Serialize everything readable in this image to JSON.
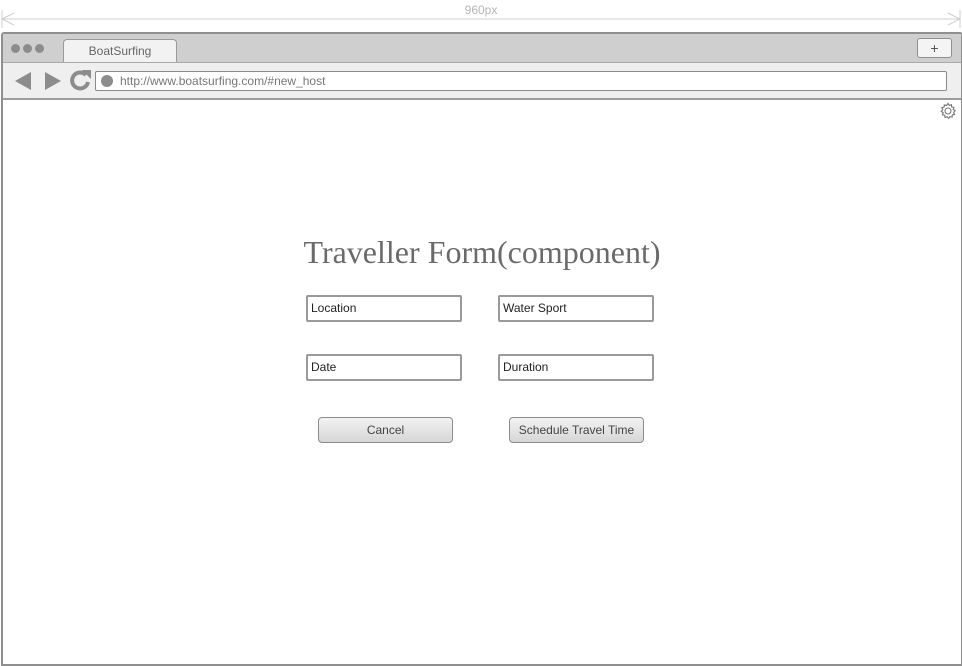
{
  "dimension_label": "960px",
  "browser": {
    "tab_title": "BoatSurfing",
    "new_tab_label": "+",
    "url": "http://www.boatsurfing.com/#new_host"
  },
  "form": {
    "title": "Traveller Form(component)",
    "fields": {
      "location": "Location",
      "water_sport": "Water Sport",
      "date": "Date",
      "duration": "Duration"
    },
    "buttons": {
      "cancel": "Cancel",
      "schedule": "Schedule Travel Time"
    }
  }
}
